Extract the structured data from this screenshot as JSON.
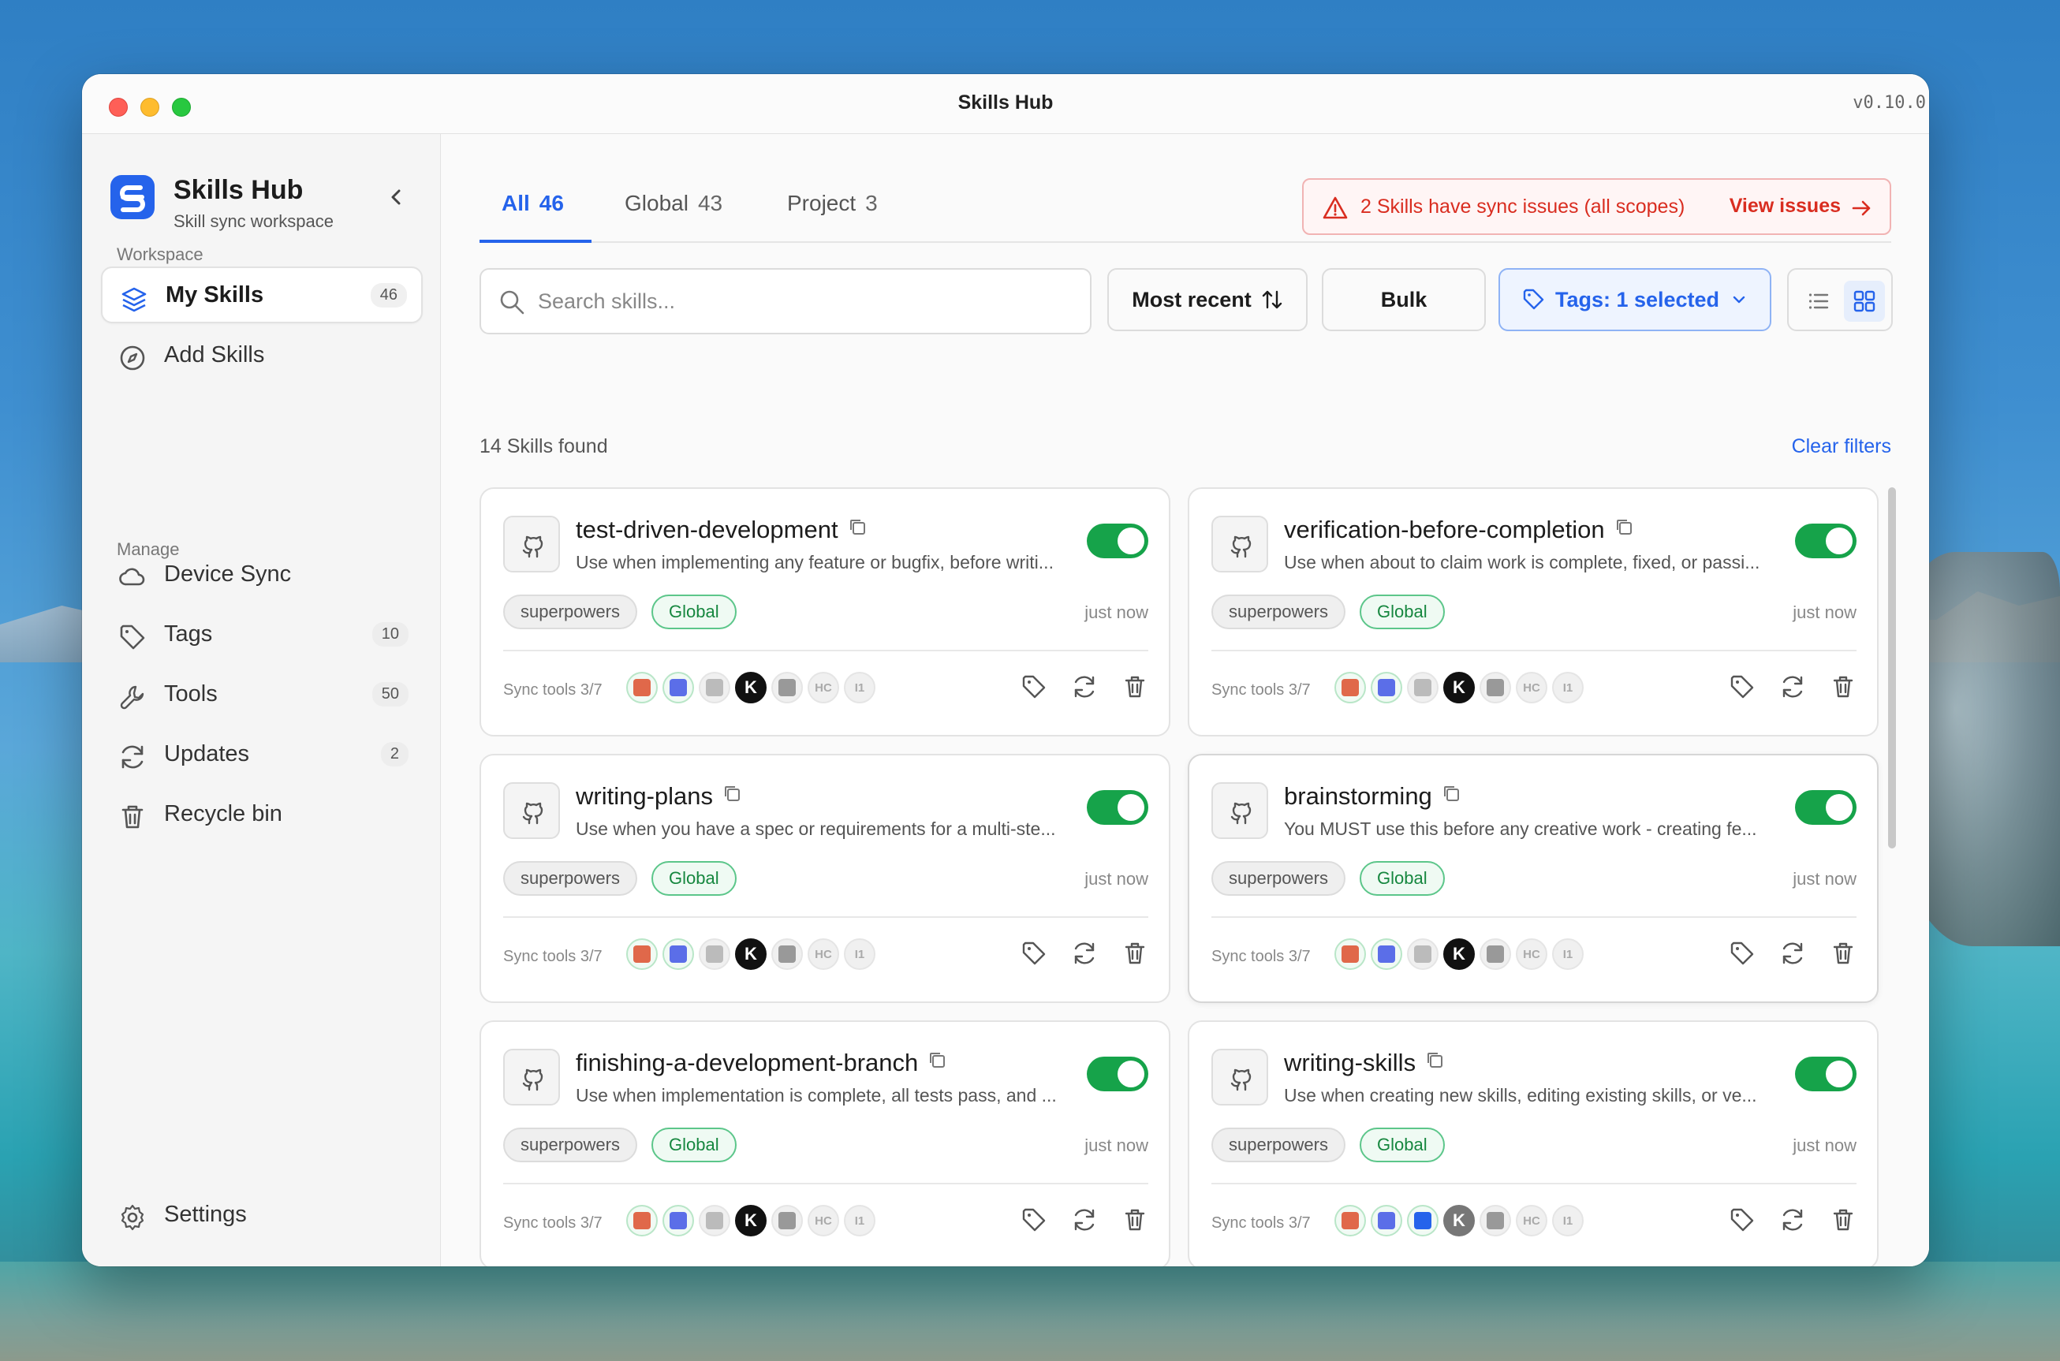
{
  "window": {
    "title": "Skills Hub",
    "version": "v0.10.0"
  },
  "brand": {
    "name": "Skills Hub",
    "subtitle": "Skill sync workspace"
  },
  "sidebar": {
    "workspace_label": "Workspace",
    "manage_label": "Manage",
    "workspace_items": [
      {
        "label": "My Skills",
        "count": "46",
        "active": true,
        "icon": "layers-icon"
      },
      {
        "label": "Add Skills",
        "count": "",
        "active": false,
        "icon": "compass-icon"
      }
    ],
    "manage_items": [
      {
        "label": "Device Sync",
        "count": "",
        "icon": "cloud-icon"
      },
      {
        "label": "Tags",
        "count": "10",
        "icon": "tag-icon"
      },
      {
        "label": "Tools",
        "count": "50",
        "icon": "wrench-icon"
      },
      {
        "label": "Updates",
        "count": "2",
        "icon": "refresh-icon"
      },
      {
        "label": "Recycle bin",
        "count": "",
        "icon": "trash-icon"
      }
    ],
    "settings_label": "Settings"
  },
  "tabs": [
    {
      "label": "All",
      "count": "46",
      "active": true
    },
    {
      "label": "Global",
      "count": "43",
      "active": false
    },
    {
      "label": "Project",
      "count": "3",
      "active": false
    }
  ],
  "issues": {
    "text": "2 Skills have sync issues (all scopes)",
    "link": "View issues"
  },
  "search": {
    "placeholder": "Search skills..."
  },
  "toolbar": {
    "sort_label": "Most recent",
    "bulk_label": "Bulk",
    "tags_label": "Tags: 1 selected"
  },
  "results": {
    "found": "14 Skills found",
    "clear": "Clear filters"
  },
  "cards": [
    {
      "title": "test-driven-development",
      "desc": "Use when implementing any feature or bugfix, before writi...",
      "tag": "superpowers",
      "scope": "Global",
      "time": "just now",
      "sync": "Sync tools 3/7",
      "enabled": true
    },
    {
      "title": "verification-before-completion",
      "desc": "Use when about to claim work is complete, fixed, or passi...",
      "tag": "superpowers",
      "scope": "Global",
      "time": "just now",
      "sync": "Sync tools 3/7",
      "enabled": true
    },
    {
      "title": "writing-plans",
      "desc": "Use when you have a spec or requirements for a multi-ste...",
      "tag": "superpowers",
      "scope": "Global",
      "time": "just now",
      "sync": "Sync tools 3/7",
      "enabled": true
    },
    {
      "title": "brainstorming",
      "desc": "You MUST use this before any creative work - creating fe...",
      "tag": "superpowers",
      "scope": "Global",
      "time": "just now",
      "sync": "Sync tools 3/7",
      "enabled": true
    },
    {
      "title": "finishing-a-development-branch",
      "desc": "Use when implementation is complete, all tests pass, and ...",
      "tag": "superpowers",
      "scope": "Global",
      "time": "just now",
      "sync": "Sync tools 3/7",
      "enabled": true
    },
    {
      "title": "writing-skills",
      "desc": "Use when creating new skills, editing existing skills, or ve...",
      "tag": "superpowers",
      "scope": "Global",
      "time": "just now",
      "sync": "Sync tools 3/7",
      "enabled": true
    }
  ],
  "tool_badges": {
    "hc": "HC",
    "i1": "I1",
    "k": "K"
  },
  "colors": {
    "accent": "#2563eb",
    "toggle_on": "#16a34a",
    "danger": "#d92d20",
    "scope_green": "#16873f"
  }
}
